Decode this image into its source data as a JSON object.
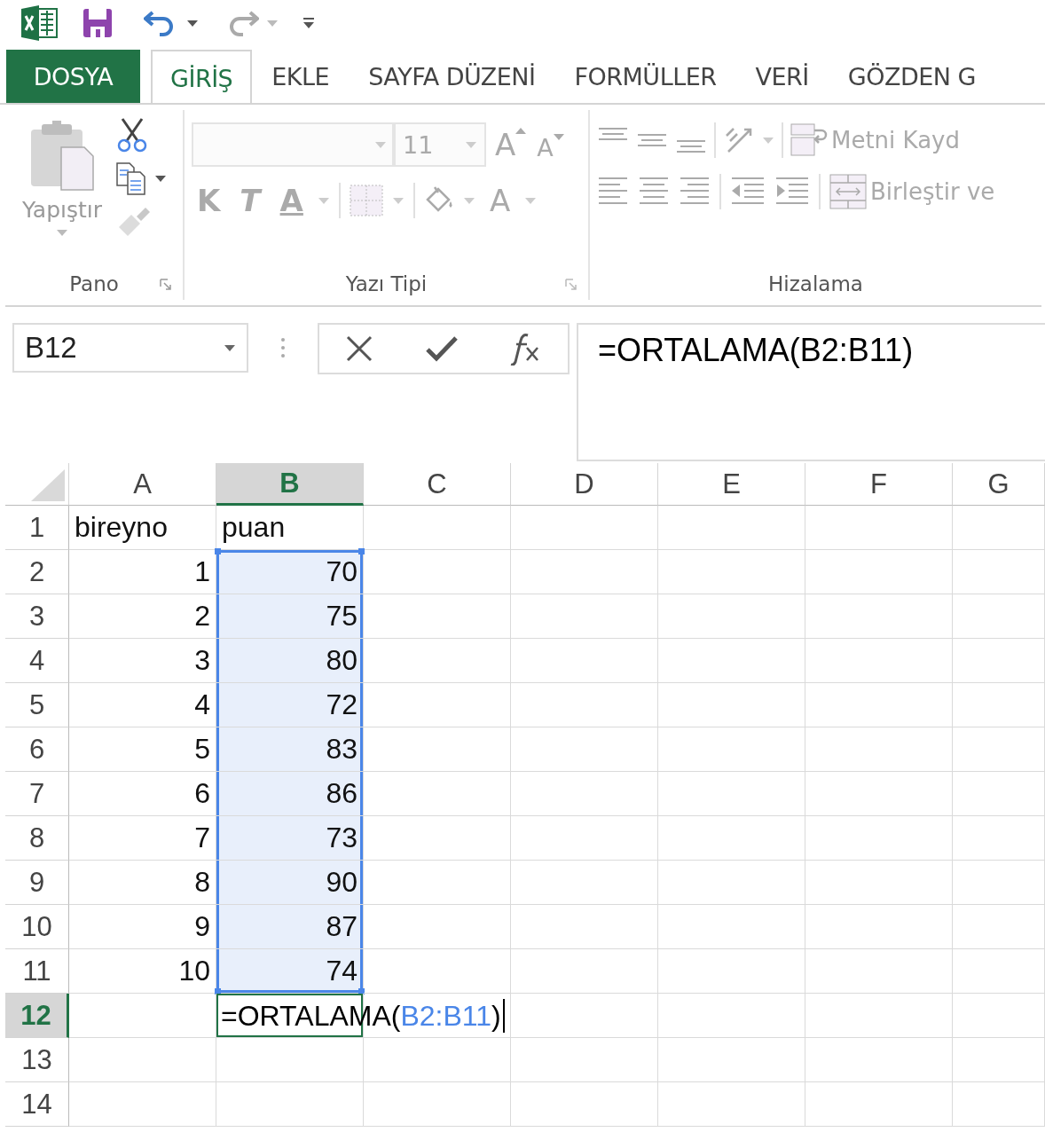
{
  "tabs": [
    {
      "label": "DOSYA",
      "kind": "file",
      "selected": false
    },
    {
      "label": "GİRİŞ",
      "kind": "tab",
      "selected": true
    },
    {
      "label": "EKLE",
      "kind": "tab",
      "selected": false
    },
    {
      "label": "SAYFA DÜZENİ",
      "kind": "tab",
      "selected": false
    },
    {
      "label": "FORMÜLLER",
      "kind": "tab",
      "selected": false
    },
    {
      "label": "VERİ",
      "kind": "tab",
      "selected": false
    },
    {
      "label": "GÖZDEN G",
      "kind": "tab",
      "selected": false
    }
  ],
  "clipboard": {
    "paste_label": "Yapıştır",
    "group_label": "Pano"
  },
  "font": {
    "font_size": "11",
    "grow_label": "A",
    "shrink_label": "A",
    "bold_label": "K",
    "italic_label": "T",
    "underline_label": "A",
    "color_label": "A",
    "group_label": "Yazı Tipi"
  },
  "alignment": {
    "wrap_label": "Metni Kayd",
    "merge_label": "Birleştir ve",
    "group_label": "Hizalama"
  },
  "name_box": "B12",
  "formula": "=ORTALAMA(B2:B11)",
  "columns": [
    {
      "label": "A",
      "selected": false
    },
    {
      "label": "B",
      "selected": true
    },
    {
      "label": "C",
      "selected": false
    },
    {
      "label": "D",
      "selected": false
    },
    {
      "label": "E",
      "selected": false
    },
    {
      "label": "F",
      "selected": false
    },
    {
      "label": "G",
      "selected": false
    }
  ],
  "rows": [
    {
      "header": "1",
      "selected": false,
      "cells": [
        {
          "text": "bireyno",
          "kind": "text",
          "in_range": false
        },
        {
          "text": "puan",
          "kind": "text",
          "in_range": false
        }
      ]
    },
    {
      "header": "2",
      "selected": false,
      "cells": [
        {
          "text": "1",
          "kind": "number",
          "in_range": false
        },
        {
          "text": "70",
          "kind": "number",
          "in_range": true
        }
      ]
    },
    {
      "header": "3",
      "selected": false,
      "cells": [
        {
          "text": "2",
          "kind": "number",
          "in_range": false
        },
        {
          "text": "75",
          "kind": "number",
          "in_range": true
        }
      ]
    },
    {
      "header": "4",
      "selected": false,
      "cells": [
        {
          "text": "3",
          "kind": "number",
          "in_range": false
        },
        {
          "text": "80",
          "kind": "number",
          "in_range": true
        }
      ]
    },
    {
      "header": "5",
      "selected": false,
      "cells": [
        {
          "text": "4",
          "kind": "number",
          "in_range": false
        },
        {
          "text": "72",
          "kind": "number",
          "in_range": true
        }
      ]
    },
    {
      "header": "6",
      "selected": false,
      "cells": [
        {
          "text": "5",
          "kind": "number",
          "in_range": false
        },
        {
          "text": "83",
          "kind": "number",
          "in_range": true
        }
      ]
    },
    {
      "header": "7",
      "selected": false,
      "cells": [
        {
          "text": "6",
          "kind": "number",
          "in_range": false
        },
        {
          "text": "86",
          "kind": "number",
          "in_range": true
        }
      ]
    },
    {
      "header": "8",
      "selected": false,
      "cells": [
        {
          "text": "7",
          "kind": "number",
          "in_range": false
        },
        {
          "text": "73",
          "kind": "number",
          "in_range": true
        }
      ]
    },
    {
      "header": "9",
      "selected": false,
      "cells": [
        {
          "text": "8",
          "kind": "number",
          "in_range": false
        },
        {
          "text": "90",
          "kind": "number",
          "in_range": true
        }
      ]
    },
    {
      "header": "10",
      "selected": false,
      "cells": [
        {
          "text": "9",
          "kind": "number",
          "in_range": false
        },
        {
          "text": "87",
          "kind": "number",
          "in_range": true
        }
      ]
    },
    {
      "header": "11",
      "selected": false,
      "cells": [
        {
          "text": "10",
          "kind": "number",
          "in_range": false
        },
        {
          "text": "74",
          "kind": "number",
          "in_range": true
        }
      ]
    },
    {
      "header": "12",
      "selected": true,
      "cells": [
        null,
        {
          "kind": "formula",
          "active": true,
          "parts": [
            {
              "text": "=ORTALAMA(",
              "kind": "plain"
            },
            {
              "text": "B2:B11",
              "kind": "reference"
            },
            {
              "text": ")",
              "kind": "plain"
            }
          ]
        }
      ]
    },
    {
      "header": "13",
      "selected": false,
      "cells": []
    },
    {
      "header": "14",
      "selected": false,
      "cells": []
    }
  ]
}
